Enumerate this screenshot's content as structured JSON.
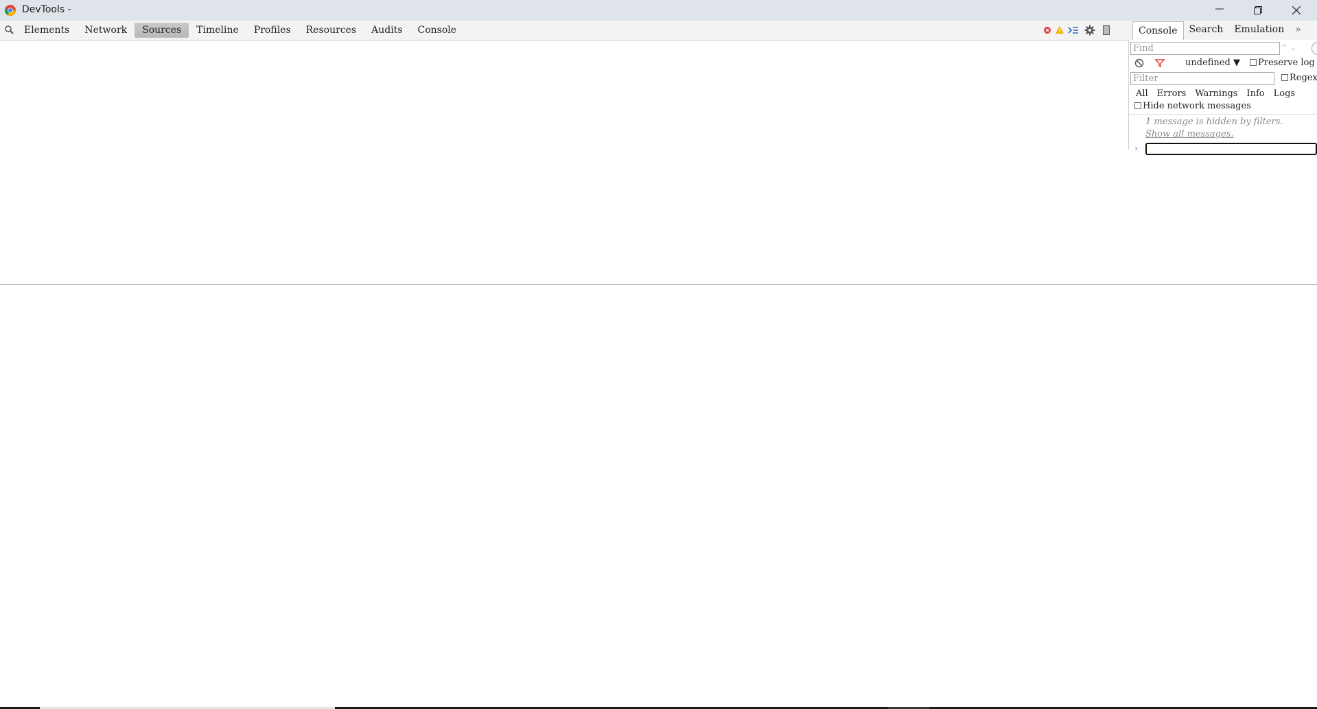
{
  "window": {
    "title": "DevTools -"
  },
  "toolbar": {
    "tabs": [
      {
        "label": "Elements"
      },
      {
        "label": "Network"
      },
      {
        "label": "Sources"
      },
      {
        "label": "Timeline"
      },
      {
        "label": "Profiles"
      },
      {
        "label": "Resources"
      },
      {
        "label": "Audits"
      },
      {
        "label": "Console"
      }
    ],
    "active_tab": "Sources"
  },
  "drawer": {
    "tabs": [
      {
        "label": "Console"
      },
      {
        "label": "Search"
      },
      {
        "label": "Emulation"
      }
    ],
    "more_label": "»"
  },
  "console": {
    "find_placeholder": "Find",
    "context": "undefined ▼",
    "preserve_log": "Preserve log",
    "filter_placeholder": "Filter",
    "regex": "Regex",
    "levels": [
      "All",
      "Errors",
      "Warnings",
      "Info",
      "Logs"
    ],
    "hide_network": "Hide network messages",
    "hidden_message": "1 message is hidden by filters.",
    "show_all": "Show all messages."
  },
  "colors": {
    "titlebar_bg": "#dfe3ea",
    "error": "#e0393e",
    "warning": "#f4b400",
    "link_blue": "#2a6bc2"
  }
}
